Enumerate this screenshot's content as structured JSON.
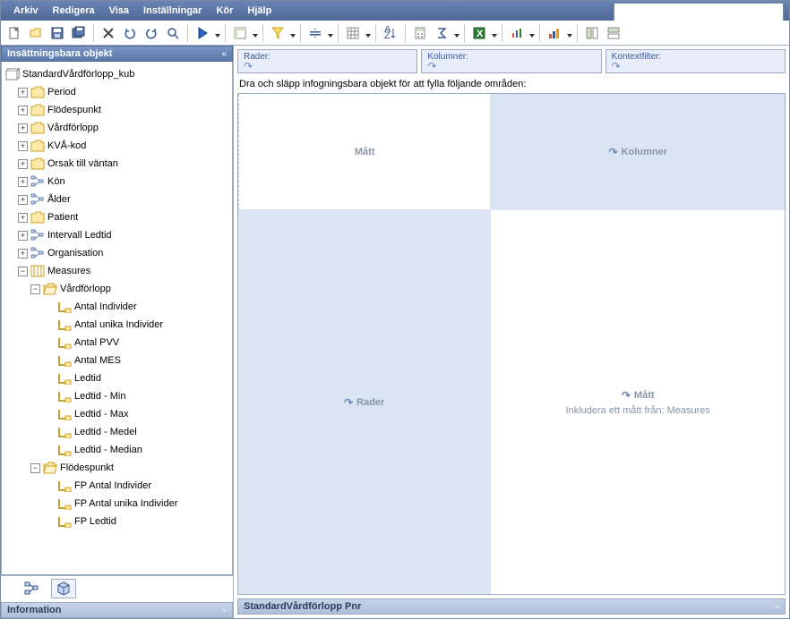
{
  "menu": [
    "Arkiv",
    "Redigera",
    "Visa",
    "Inställningar",
    "Kör",
    "Hjälp"
  ],
  "left_panel_title": "Insättningsbara objekt",
  "info_panel_title": "Information",
  "right_bottom_title": "StandardVårdförlopp Pnr",
  "cube_name": "StandardVårdförlopp_kub",
  "tree": {
    "dims": [
      "Period",
      "Flödespunkt",
      "Vårdförlopp",
      "KVÅ-kod",
      "Orsak till väntan",
      "Kön",
      "Ålder",
      "Patient",
      "Intervall Ledtid",
      "Organisation"
    ],
    "measures_label": "Measures",
    "measures": {
      "Vårdförlopp": [
        "Antal Individer",
        "Antal unika Individer",
        "Antal PVV",
        "Antal MES",
        "Ledtid",
        "Ledtid - Min",
        "Ledtid - Max",
        "Ledtid - Medel",
        "Ledtid - Median"
      ],
      "Flödespunkt": [
        "FP Antal Individer",
        "FP Antal unika Individer",
        "FP Ledtid"
      ]
    }
  },
  "drop_headers": {
    "rader": "Rader:",
    "kolumner": "Kolumner:",
    "kontext": "Kontextfilter:"
  },
  "instruction": "Dra och släpp infogningsbara objekt för att fylla följande områden:",
  "cells": {
    "tl": "Mått",
    "tr": "Kolumner",
    "bl": "Rader",
    "br_title": "Mått",
    "br_sub": "Inkludera ett mått från: Measures"
  }
}
